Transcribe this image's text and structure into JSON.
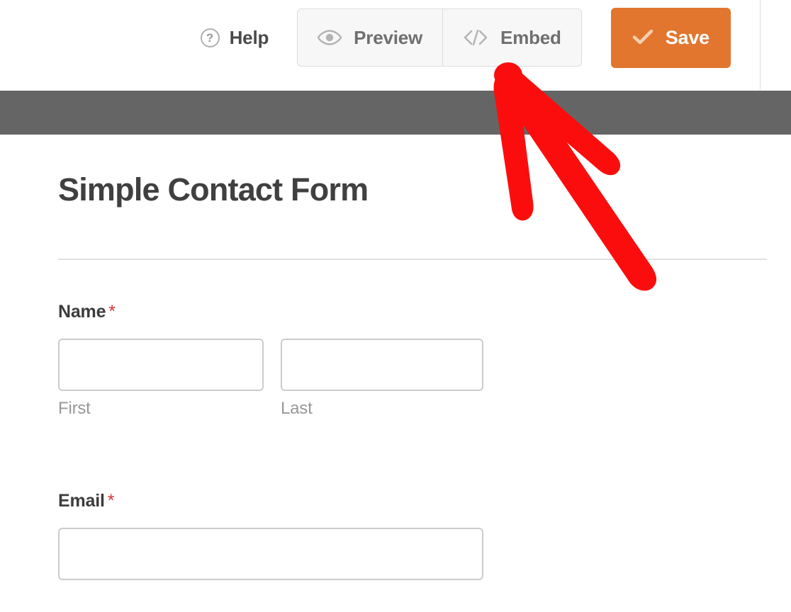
{
  "toolbar": {
    "help": {
      "label": "Help",
      "icon": "question-circle-icon",
      "glyph": "?"
    },
    "preview": {
      "label": "Preview",
      "icon": "eye-icon"
    },
    "embed": {
      "label": "Embed",
      "icon": "code-brackets-icon"
    },
    "save": {
      "label": "Save",
      "icon": "check-icon"
    }
  },
  "form_preview": {
    "title": "Simple Contact Form",
    "fields": [
      {
        "label": "Name",
        "required": true,
        "required_marker": "*",
        "type": "name",
        "sub_fields": [
          {
            "sub_label": "First",
            "value": "",
            "placeholder": ""
          },
          {
            "sub_label": "Last",
            "value": "",
            "placeholder": ""
          }
        ]
      },
      {
        "label": "Email",
        "required": true,
        "required_marker": "*",
        "type": "email",
        "value": "",
        "placeholder": ""
      }
    ]
  },
  "annotation": {
    "type": "hand-drawn-arrow",
    "color": "#fc0d0d",
    "points_to": "embed-button"
  },
  "colors": {
    "save_button_bg": "#e2762f",
    "toolbar_button_bg": "#f7f7f7",
    "toolbar_button_border": "#dcdcdc",
    "preview_backdrop": "#656565",
    "required_star": "#d63638",
    "annotation_red": "#fc0d0d",
    "title_text": "#404040",
    "label_text": "#3c3c3c",
    "sub_label_text": "#989898",
    "input_border": "#cccccc"
  }
}
